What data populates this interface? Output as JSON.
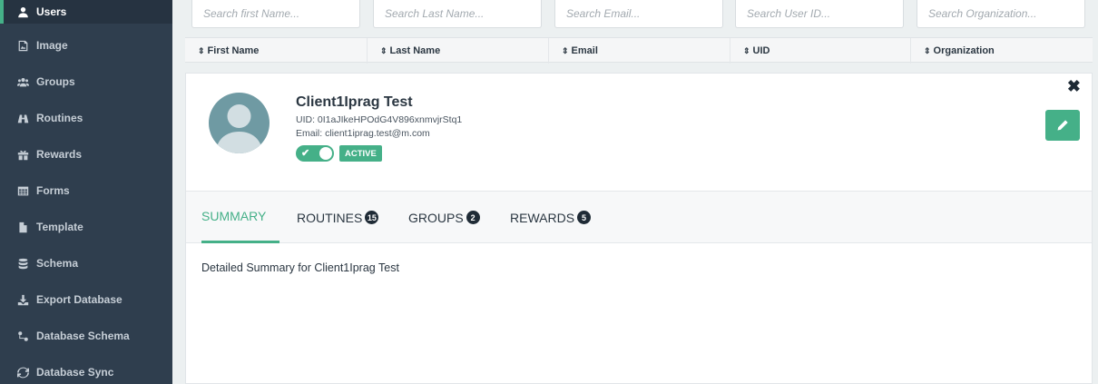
{
  "sidebar": {
    "items": [
      {
        "label": "Users",
        "icon": "user-icon",
        "active": true
      },
      {
        "label": "Image",
        "icon": "image-icon"
      },
      {
        "label": "Groups",
        "icon": "groups-icon"
      },
      {
        "label": "Routines",
        "icon": "binoculars-icon"
      },
      {
        "label": "Rewards",
        "icon": "gift-icon"
      },
      {
        "label": "Forms",
        "icon": "table-icon"
      },
      {
        "label": "Template",
        "icon": "file-icon"
      },
      {
        "label": "Schema",
        "icon": "database-icon"
      },
      {
        "label": "Export Database",
        "icon": "download-icon"
      },
      {
        "label": "Database Schema",
        "icon": "sitemap-icon"
      },
      {
        "label": "Database Sync",
        "icon": "sync-icon"
      }
    ]
  },
  "search": {
    "first_name_placeholder": "Search first Name...",
    "last_name_placeholder": "Search Last Name...",
    "email_placeholder": "Search Email...",
    "uid_placeholder": "Search User ID...",
    "organization_placeholder": "Search Organization..."
  },
  "columns": {
    "first_name": "First Name",
    "last_name": "Last Name",
    "email": "Email",
    "uid": "UID",
    "organization": "Organization"
  },
  "user": {
    "name": "Client1Iprag Test",
    "uid": "UID: 0I1aJIkeHPOdG4V896xnmvjrStq1",
    "email": "Email: client1iprag.test@m.com",
    "status": "ACTIVE",
    "toggle_check": "✔"
  },
  "tabs": [
    {
      "label": "SUMMARY",
      "count": null
    },
    {
      "label": "ROUTINES",
      "count": "15"
    },
    {
      "label": "GROUPS",
      "count": "2"
    },
    {
      "label": "REWARDS",
      "count": "5"
    }
  ],
  "summary": {
    "text": "Detailed Summary for Client1Iprag Test"
  },
  "close_glyph": "✖",
  "sort_glyph": "⇕",
  "colors": {
    "accent": "#45b088",
    "sidebar_bg": "#2f3e4e",
    "badge_dark": "#1f2b36"
  }
}
